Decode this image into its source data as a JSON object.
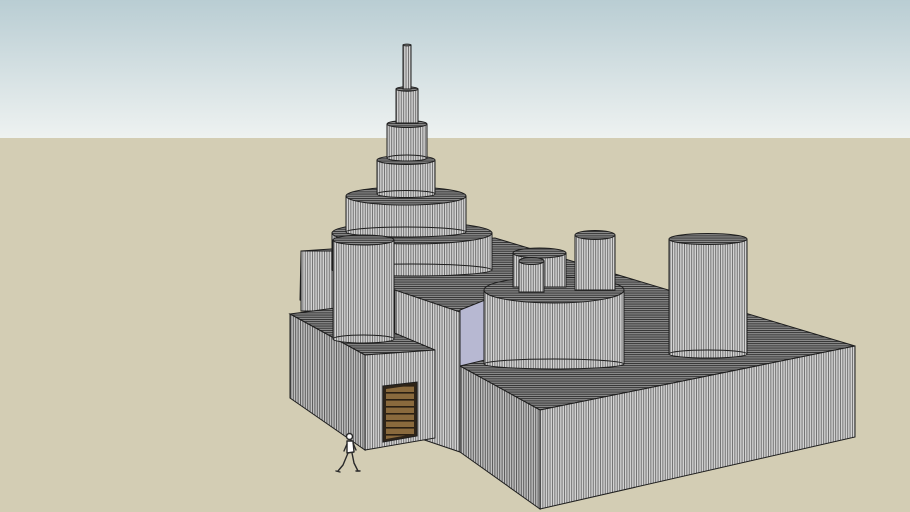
{
  "scene": {
    "colors": {
      "sky_top": "#b9cdd3",
      "sky_bottom": "#eef2f1",
      "ground": "#d3cdb4",
      "wall_light": "#cfcfcf",
      "wall_mid": "#b9b9b9",
      "wall_dark": "#a4a4a4",
      "roof": "#5f5f5f",
      "outline": "#1e1e1e",
      "glass": "#b7b8d2",
      "door_wood": "#7a5c33",
      "door_frame": "#2e2418"
    },
    "icons": {
      "figure": "walking-person-icon"
    }
  }
}
